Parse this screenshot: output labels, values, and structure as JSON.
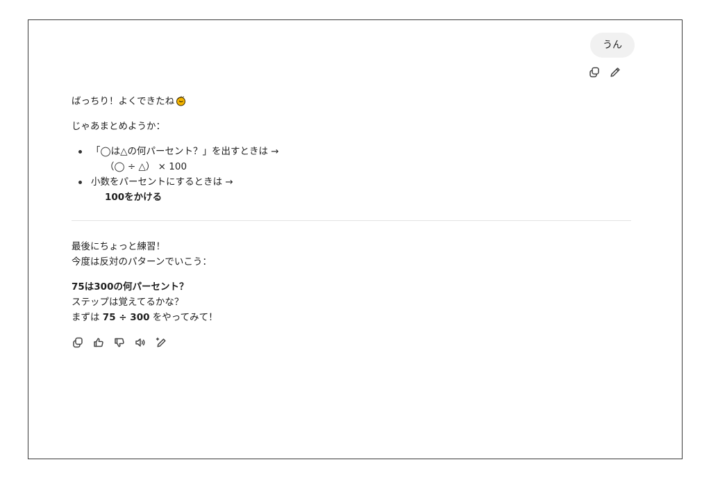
{
  "user_message": {
    "text": "うん"
  },
  "user_actions": {
    "copy_icon": "copy-icon",
    "edit_icon": "pencil-icon"
  },
  "assistant": {
    "greeting": "ばっちり！よくできたね",
    "greeting_emoji": "clapping-hands-emoji",
    "summary_intro": "じゃあまとめようか：",
    "points": [
      {
        "text": "「◯は△の何パーセント？」を出すときは →",
        "sub": "（◯ ÷ △） × 100"
      },
      {
        "text": "小数をパーセントにするときは →",
        "sub": "100をかける"
      }
    ],
    "practice_line1": "最後にちょっと練習！",
    "practice_line2": "今度は反対のパターンでいこう：",
    "question": "75は300の何パーセント？",
    "hint1": "ステップは覚えてるかな？",
    "hint2_prefix": "まずは ",
    "hint2_expr": "75 ÷ 300",
    "hint2_suffix": " をやってみて！"
  },
  "response_actions": {
    "icons": [
      "copy-icon",
      "thumbs-up-icon",
      "thumbs-down-icon",
      "speaker-icon",
      "edit-sparkle-icon"
    ]
  },
  "colors": {
    "bubble_bg": "#f1f1f1",
    "divider": "#e2e2e2",
    "icon_stroke": "#444444"
  }
}
